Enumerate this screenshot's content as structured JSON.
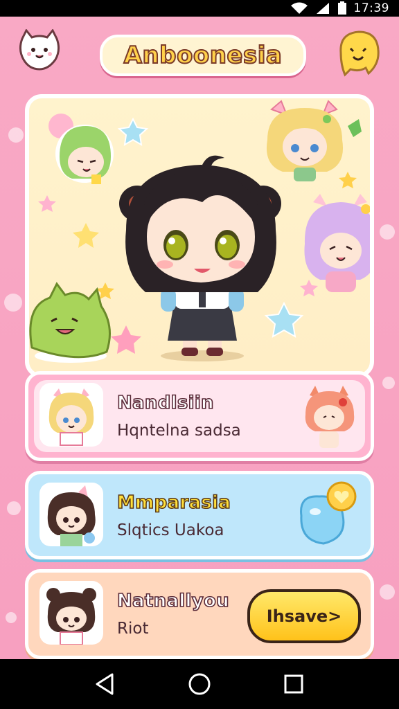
{
  "status_bar": {
    "time": "17:39",
    "icons": [
      "wifi-icon",
      "signal-icon",
      "battery-icon"
    ]
  },
  "header": {
    "title": "Anboonesia",
    "left_mascot": "white-cat-mascot-icon",
    "right_mascot": "yellow-blob-mascot-icon"
  },
  "hero": {
    "characters": [
      "main-chibi-girl",
      "green-hair-chibi",
      "blonde-cat-ear-chibi",
      "purple-hair-chibi",
      "green-slime-mascot"
    ]
  },
  "list": [
    {
      "title": "Nandlsiin",
      "subtitle": "Hqntelna sadsa"
    },
    {
      "title": "Mmparasia",
      "subtitle": "Slqtics Uakoa",
      "badge_icon": "heart-badge-icon"
    },
    {
      "title": "Natnallyou",
      "subtitle": "Riot",
      "button_label": "Ihsave>"
    }
  ],
  "nav": {
    "back": "back-icon",
    "home": "home-icon",
    "recents": "recents-icon"
  },
  "colors": {
    "background": "#f7a0c0",
    "hero_card": "#fff3cd",
    "card_pink": "#ffb3cf",
    "card_blue": "#bfe7fb",
    "card_peach": "#ffd7bd",
    "title_yellow": "#ffd14a",
    "button_yellow": "#ffc21a"
  }
}
